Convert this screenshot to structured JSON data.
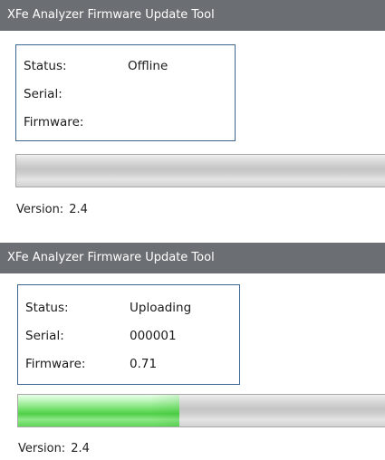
{
  "panels": [
    {
      "title": "XFe Analyzer Firmware Update Tool",
      "status_label": "Status:",
      "status_value": "Offline",
      "serial_label": "Serial:",
      "serial_value": "",
      "firmware_label": "Firmware:",
      "firmware_value": "",
      "progress_fraction": 0.0,
      "version_label": "Version:",
      "version_value": "2.4"
    },
    {
      "title": "XFe Analyzer Firmware Update Tool",
      "status_label": "Status:",
      "status_value": "Uploading",
      "serial_label": "Serial:",
      "serial_value": "000001",
      "firmware_label": "Firmware:",
      "firmware_value": "0.71",
      "progress_fraction": 0.44,
      "version_label": "Version:",
      "version_value": "2.4"
    }
  ],
  "colors": {
    "titlebar": "#6b6e72",
    "box_border": "#3c6691",
    "progress_green": "#4fcf47"
  }
}
